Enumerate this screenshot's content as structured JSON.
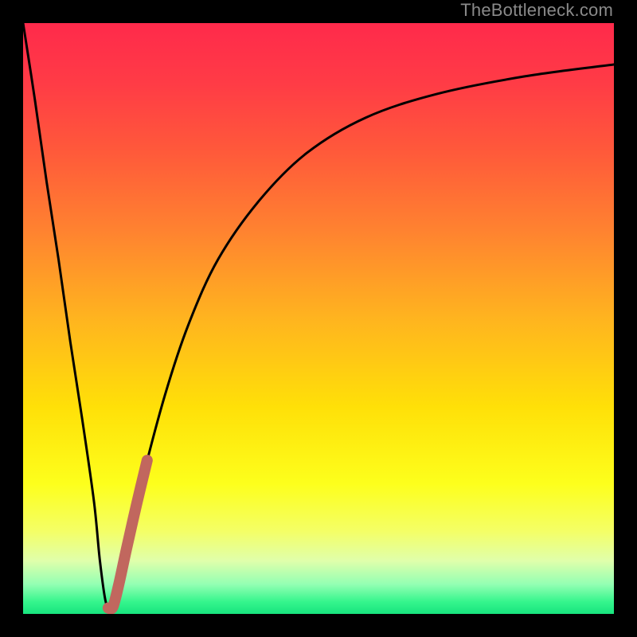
{
  "watermark": "TheBottleneck.com",
  "colors": {
    "frame": "#000000",
    "curve": "#000000",
    "highlight": "#c1675e",
    "watermark": "#8a8a8a"
  },
  "gradient_stops": [
    {
      "pct": 0,
      "color": "#ff2a4b"
    },
    {
      "pct": 10,
      "color": "#ff3b46"
    },
    {
      "pct": 22,
      "color": "#ff5a3a"
    },
    {
      "pct": 35,
      "color": "#ff8230"
    },
    {
      "pct": 50,
      "color": "#ffb41f"
    },
    {
      "pct": 65,
      "color": "#ffe008"
    },
    {
      "pct": 78,
      "color": "#fdff1c"
    },
    {
      "pct": 86,
      "color": "#f4ff66"
    },
    {
      "pct": 91,
      "color": "#e0ffab"
    },
    {
      "pct": 95,
      "color": "#93ffb3"
    },
    {
      "pct": 98,
      "color": "#34f58c"
    },
    {
      "pct": 100,
      "color": "#18e47e"
    }
  ],
  "chart_data": {
    "type": "line",
    "title": "",
    "xlabel": "",
    "ylabel": "",
    "xlim": [
      0,
      100
    ],
    "ylim": [
      0,
      100
    ],
    "series": [
      {
        "name": "bottleneck-curve",
        "x": [
          0,
          2,
          4,
          6,
          8,
          10,
          12,
          13,
          14,
          15,
          17,
          20,
          24,
          28,
          33,
          40,
          48,
          58,
          70,
          85,
          100
        ],
        "y": [
          100,
          87,
          73,
          60,
          46,
          33,
          19,
          9,
          2,
          1,
          9,
          22,
          37,
          49,
          60,
          70,
          78,
          84,
          88,
          91,
          93
        ]
      },
      {
        "name": "highlight-segment",
        "x": [
          14.4,
          15.2,
          16.2,
          17.5,
          19.2,
          21.0
        ],
        "y": [
          1.0,
          1.2,
          5.0,
          11.0,
          18.5,
          26.0
        ]
      }
    ]
  }
}
